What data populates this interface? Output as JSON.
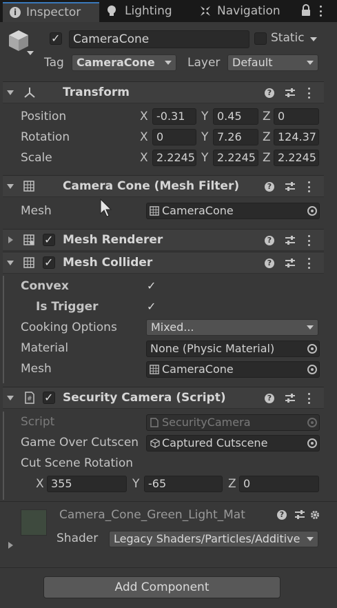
{
  "tabs": [
    {
      "label": "Inspector",
      "icon": "info-icon",
      "active": true
    },
    {
      "label": "Lighting",
      "icon": "bulb-icon",
      "active": false
    },
    {
      "label": "Navigation",
      "icon": "navigation-icon",
      "active": false
    }
  ],
  "object": {
    "name": "CameraCone",
    "active": true,
    "static_label": "Static",
    "tag_label": "Tag",
    "tag_value": "CameraCone",
    "layer_label": "Layer",
    "layer_value": "Default"
  },
  "transform": {
    "title": "Transform",
    "rows": [
      {
        "label": "Position",
        "x": "-0.31",
        "y": "0.45",
        "z": "0"
      },
      {
        "label": "Rotation",
        "x": "0",
        "y": "7.26",
        "z": "124.37"
      },
      {
        "label": "Scale",
        "x": "2.2245",
        "y": "2.2245",
        "z": "2.2245"
      }
    ],
    "axis_x": "X",
    "axis_y": "Y",
    "axis_z": "Z"
  },
  "mesh_filter": {
    "title": "Camera Cone (Mesh Filter)",
    "mesh_label": "Mesh",
    "mesh_value": "CameraCone"
  },
  "mesh_renderer": {
    "title": "Mesh Renderer",
    "enabled": true
  },
  "mesh_collider": {
    "title": "Mesh Collider",
    "enabled": true,
    "convex_label": "Convex",
    "convex": true,
    "trigger_label": "Is Trigger",
    "trigger": true,
    "cooking_label": "Cooking Options",
    "cooking_value": "Mixed...",
    "material_label": "Material",
    "material_value": "None (Physic Material)",
    "mesh_label": "Mesh",
    "mesh_value": "CameraCone"
  },
  "security_camera": {
    "title": "Security Camera (Script)",
    "enabled": true,
    "script_label": "Script",
    "script_value": "SecurityCamera",
    "cutscene_label": "Game Over Cutscen",
    "cutscene_value": "Captured Cutscene",
    "rotation_label": "Cut Scene Rotation",
    "rot_x": "355",
    "rot_y": "-65",
    "rot_z": "0"
  },
  "material": {
    "name": "Camera_Cone_Green_Light_Mat",
    "shader_label": "Shader",
    "shader_value": "Legacy Shaders/Particles/Additive",
    "preview_color": "#3e4a3e"
  },
  "add_component_label": "Add Component",
  "colors": {
    "background": "#383838",
    "tab_bar": "#191919",
    "active_tab_accent": "#3a79bb",
    "field": "#2a2a2a",
    "dropdown": "#515151"
  }
}
